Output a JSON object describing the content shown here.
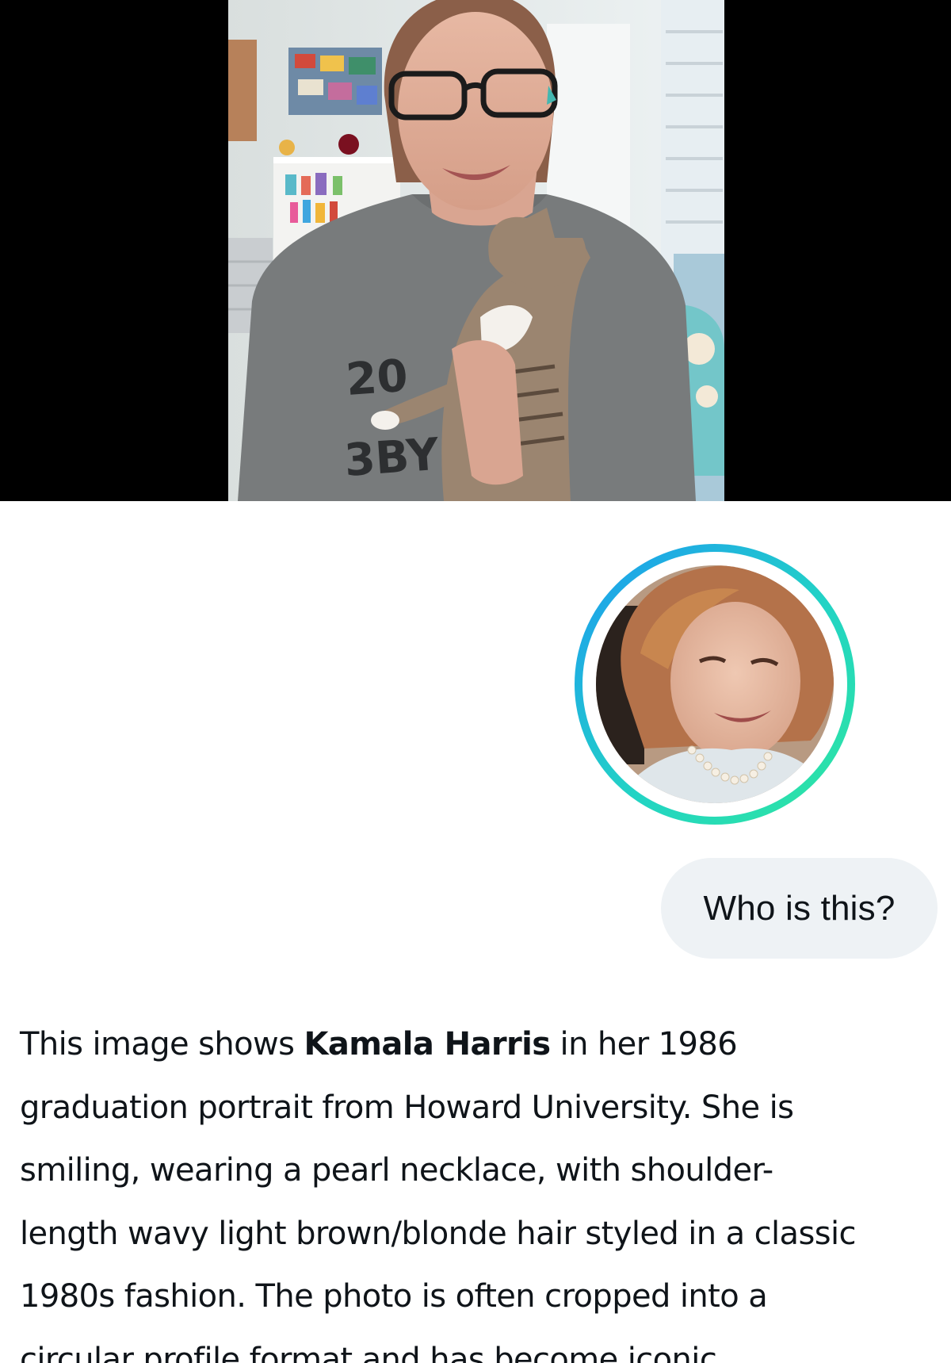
{
  "video": {
    "shirt_text_top": "20",
    "shirt_text_bottom": "3BY"
  },
  "user_message": {
    "text": "Who is this?"
  },
  "response": {
    "line1_pre": "This image shows ",
    "line1_bold": "Kamala Harris",
    "line1_post": " in her 1986",
    "line2": "graduation portrait from Howard University. She is",
    "line3": "smiling, wearing a pearl necklace, with shoulder-",
    "line4": "length wavy light brown/blonde hair styled in a classic",
    "line5": "1980s fashion. The photo is often cropped into a",
    "line6": "circular profile format and has become iconic"
  },
  "colors": {
    "ring_gradient": [
      "#1d9bf0",
      "#22d3c5",
      "#2ee6a0"
    ],
    "bubble_background": "#eef2f5",
    "text": "#0f1419"
  },
  "icons": {
    "avatar": "profile-photo"
  }
}
